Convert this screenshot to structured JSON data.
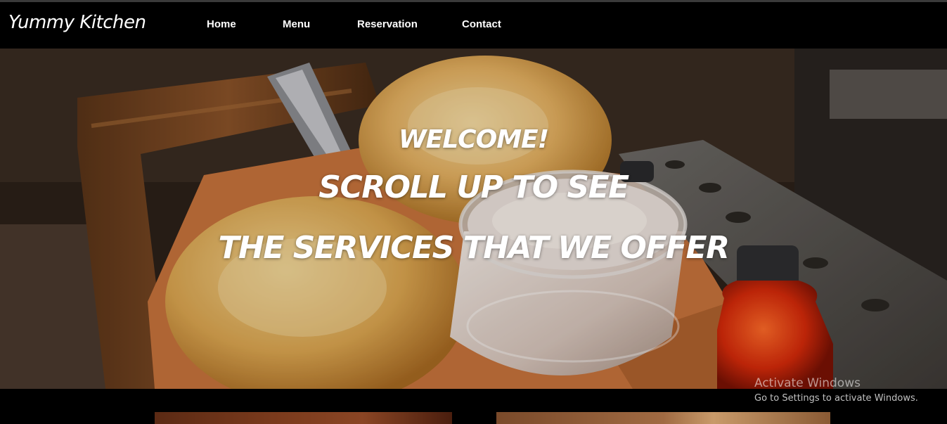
{
  "brand": {
    "name": "Yummy Kitchen"
  },
  "nav": {
    "items": [
      {
        "label": "Home"
      },
      {
        "label": "Menu"
      },
      {
        "label": "Reservation"
      },
      {
        "label": "Contact"
      }
    ]
  },
  "hero": {
    "welcome": "WELCOME!",
    "line1": "SCROLL UP TO SEE",
    "line2": "THE SERVICES THAT WE OFFER"
  },
  "watermark": {
    "title": "Activate Windows",
    "subtitle": "Go to Settings to activate Windows."
  }
}
